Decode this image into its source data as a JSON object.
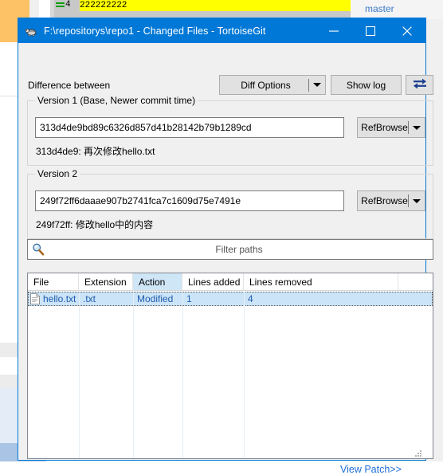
{
  "background": {
    "diff_marker": "=",
    "diff_line_number": "4",
    "diff_line_text": "222222222",
    "branch_label": "master"
  },
  "window": {
    "icon": "tortoisegit-turtle-icon",
    "title": "F:\\repositorys\\repo1 - Changed Files - TortoiseGit",
    "minimize_icon": "minimize-icon",
    "maximize_icon": "maximize-icon",
    "close_icon": "close-icon"
  },
  "toolbar": {
    "difference_between_label": "Difference between",
    "diff_options_label": "Diff Options",
    "diff_options_arrow_icon": "chevron-down-icon",
    "show_log_label": "Show log",
    "swap_icon": "swap-versions-icon"
  },
  "version1": {
    "group_caption": "Version 1 (Base, Newer commit time)",
    "hash_value": "313d4de9bd89c6326d857d41b28142b79b1289cd",
    "ref_browse_label": "RefBrowse",
    "ref_browse_arrow_icon": "chevron-down-icon",
    "commit_summary": "313d4de9: 再次修改hello.txt"
  },
  "version2": {
    "group_caption": "Version 2",
    "hash_value": "249f72ff6daaae907b2741fca7c1609d75e7491e",
    "ref_browse_label": "RefBrowse",
    "ref_browse_arrow_icon": "chevron-down-icon",
    "commit_summary": "249f72ff: 修改hello中的内容"
  },
  "filter": {
    "icon": "search-icon",
    "placeholder": "Filter paths",
    "value": ""
  },
  "file_list": {
    "columns": [
      {
        "label": "File",
        "width": 64,
        "sorted": false
      },
      {
        "label": "Extension",
        "width": 68,
        "sorted": false
      },
      {
        "label": "Action",
        "width": 62,
        "sorted": true
      },
      {
        "label": "Lines added",
        "width": 77,
        "sorted": false
      },
      {
        "label": "Lines removed",
        "width": 194,
        "sorted": false
      }
    ],
    "rows": [
      {
        "icon": "text-file-icon",
        "file": "hello.txt",
        "extension": ".txt",
        "action": "Modified",
        "lines_added": "1",
        "lines_removed": "4",
        "selected": true
      }
    ]
  },
  "footer": {
    "view_patch_label": "View Patch>>",
    "resize_grip_icon": "resize-grip-icon"
  },
  "colors": {
    "accent": "#0078d7",
    "selection": "#cbe4f7",
    "link": "#1e6fd9",
    "sorted_header": "#cfe6f7",
    "dialog_face": "#f0f0f0",
    "diff_highlight": "#ffff00"
  }
}
